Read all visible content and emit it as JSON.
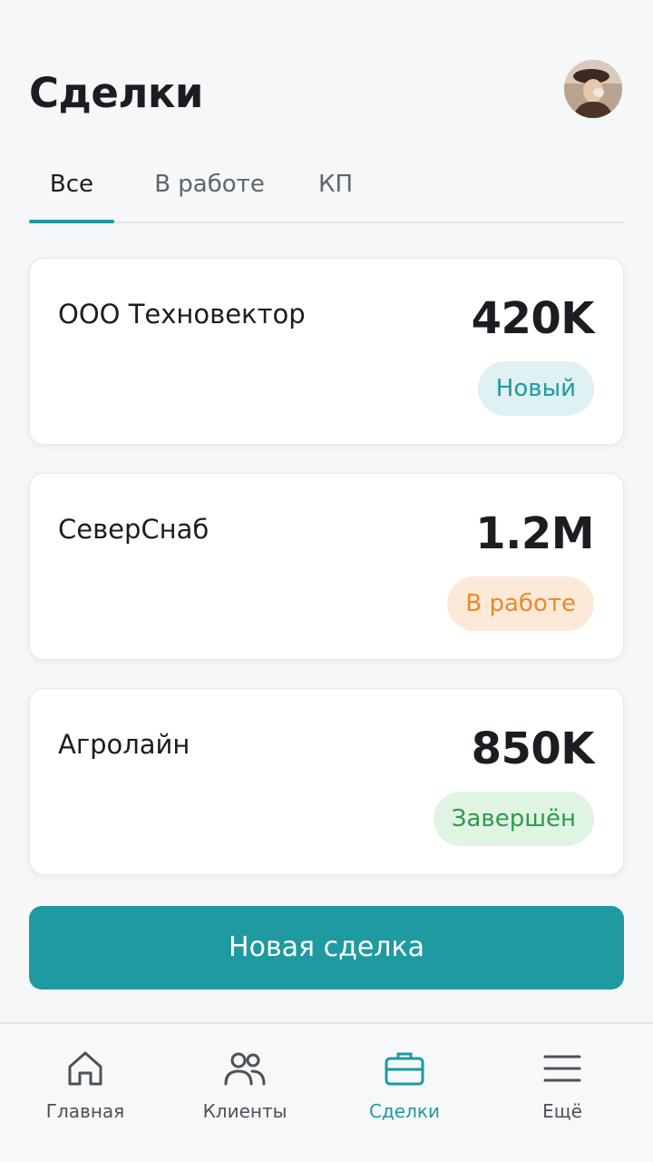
{
  "header": {
    "title": "Сделки",
    "avatar_icon": "user-avatar"
  },
  "tabs": [
    {
      "label": "Все",
      "active": true
    },
    {
      "label": "В работе",
      "active": false
    },
    {
      "label": "КП",
      "active": false
    }
  ],
  "deals": [
    {
      "name": "ООО Техновектор",
      "amount": "420K",
      "status": "Новый",
      "status_type": "new"
    },
    {
      "name": "СеверСнаб",
      "amount": "1.2M",
      "status": "В работе",
      "status_type": "in-progress"
    },
    {
      "name": "Агролайн",
      "amount": "850K",
      "status": "Завершён",
      "status_type": "done"
    }
  ],
  "actions": {
    "new_deal_label": "Новая сделка"
  },
  "bottom_nav": [
    {
      "label": "Главная",
      "icon": "home-icon",
      "active": false
    },
    {
      "label": "Клиенты",
      "icon": "users-icon",
      "active": false
    },
    {
      "label": "Сделки",
      "icon": "briefcase-icon",
      "active": true
    },
    {
      "label": "Ещё",
      "icon": "menu-icon",
      "active": false
    }
  ],
  "colors": {
    "accent": "#1e9aa0",
    "status_new_bg": "#dff1f3",
    "status_in_progress_bg": "#fde9d8",
    "status_in_progress_text": "#e68a2e",
    "status_done_bg": "#e0f4e3",
    "status_done_text": "#2e9a4a"
  }
}
